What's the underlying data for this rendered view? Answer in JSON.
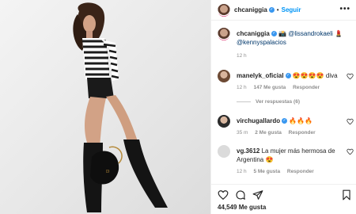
{
  "post": {
    "username": "chcaniggia",
    "follow_label": "Seguir",
    "separator": "•",
    "more_label": "•••",
    "caption": {
      "username": "chcaniggia",
      "text_prefix": " 📸 ",
      "mention_1": "@lissandrokaeli",
      "text_mid": " 💄 ",
      "mention_2": "@kennyspalacios",
      "time": "12 h"
    },
    "likes": "44,549 Me gusta"
  },
  "comments": [
    {
      "username": "manelyk_oficial",
      "text": " 😍😍😍😍 diva",
      "time": "12 h",
      "likes": "147 Me gusta",
      "reply": "Responder",
      "view_replies": "Ver respuestas (6)"
    },
    {
      "username": "virchugallardo",
      "text": " 🔥🔥🔥",
      "time": "35 m",
      "likes": "2 Me gusta",
      "reply": "Responder"
    },
    {
      "username": "vg.3612",
      "text": " La mujer más hermosa de Argentina 😍",
      "time": "12 h",
      "likes": "5 Me gusta",
      "reply": "Responder"
    }
  ],
  "icons": {
    "verified": "verified-badge-icon",
    "heart": "heart-icon",
    "comment": "comment-icon",
    "share": "share-icon",
    "save": "bookmark-icon",
    "more": "more-options-icon"
  },
  "colors": {
    "accent": "#0095f6",
    "verified": "#3897f0",
    "muted": "#8e8e8e",
    "mention": "#00376b"
  }
}
